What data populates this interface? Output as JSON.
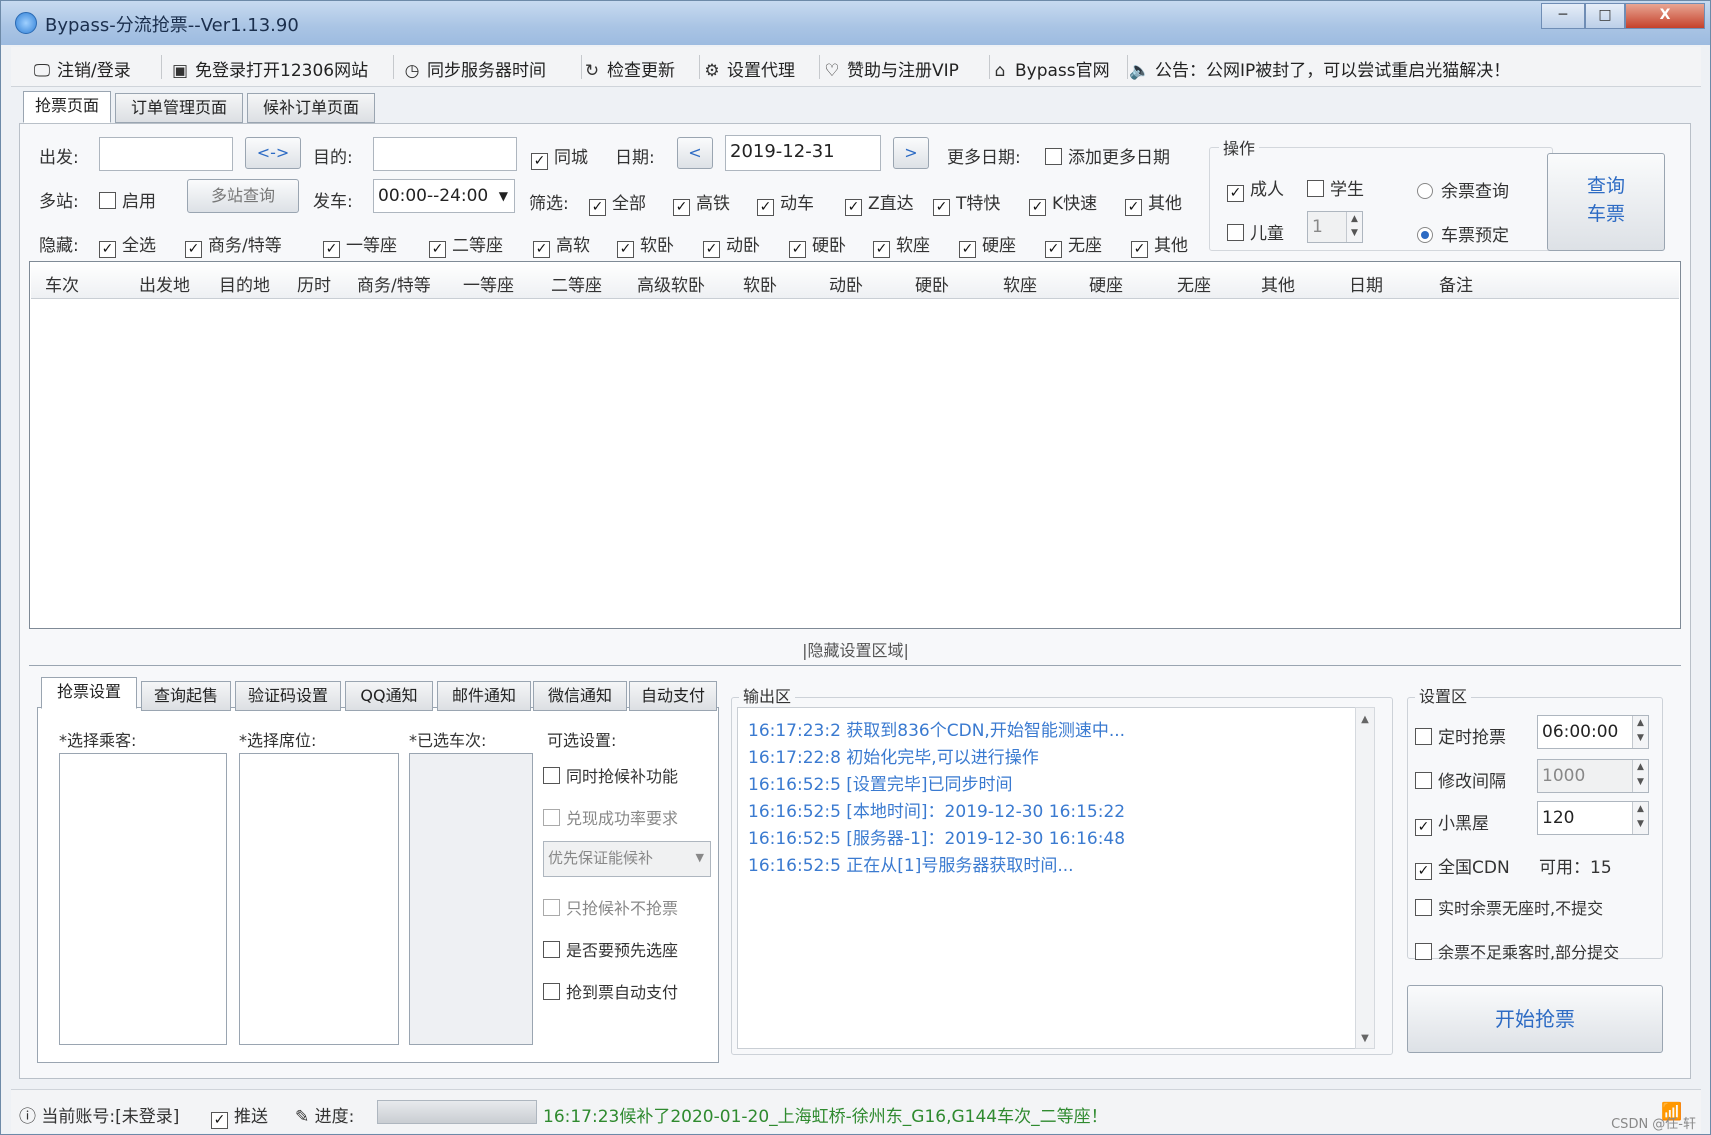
{
  "window": {
    "title": "Bypass-分流抢票--Ver1.13.90",
    "controls": {
      "minimize": "─",
      "maximize": "□",
      "close": "X"
    }
  },
  "toolbar": {
    "items": [
      {
        "icon": "🖵",
        "label": "注销/登录"
      },
      {
        "icon": "▣",
        "label": "免登录打开12306网站"
      },
      {
        "icon": "◷",
        "label": "同步服务器时间"
      },
      {
        "icon": "↻",
        "label": "检查更新"
      },
      {
        "icon": "⚙",
        "label": "设置代理"
      },
      {
        "icon": "♡",
        "label": "赞助与注册VIP"
      },
      {
        "icon": "⌂",
        "label": "Bypass官网"
      },
      {
        "icon": "🔈",
        "label": "公告：公网IP被封了，可以尝试重启光猫解决！"
      }
    ]
  },
  "main_tabs": [
    "抢票页面",
    "订单管理页面",
    "候补订单页面"
  ],
  "query": {
    "from_label": "出发:",
    "from_value": "",
    "swap_label": "<->",
    "to_label": "目的:",
    "to_value": "",
    "same_city_label": "同城",
    "same_city_checked": "✓",
    "date_label": "日期:",
    "date_prev": "<",
    "date_value": "2019-12-31",
    "date_next": ">",
    "more_dates_label": "更多日期:",
    "add_more_dates_label": "添加更多日期",
    "multi_station_label": "多站:",
    "enable_label": "启用",
    "multi_station_query": "多站查询",
    "depart_label": "发车:",
    "depart_value": "00:00--24:00",
    "filter_label": "筛选:",
    "filters": [
      "全部",
      "高铁",
      "动车",
      "Z直达",
      "T特快",
      "K快速",
      "其他"
    ],
    "hide_label": "隐藏:",
    "hides": [
      "全选",
      "商务/特等",
      "一等座",
      "二等座",
      "高软",
      "软卧",
      "动卧",
      "硬卧",
      "软座",
      "硬座",
      "无座",
      "其他"
    ]
  },
  "operation": {
    "group_label": "操作",
    "adult_label": "成人",
    "student_label": "学生",
    "child_label": "儿童",
    "child_count": "1",
    "radio_remaining": "余票查询",
    "radio_reserve": "车票预定",
    "query_button": "查询\n车票",
    "query_line1": "查询",
    "query_line2": "车票"
  },
  "grid": {
    "columns": [
      "车次",
      "出发地",
      "目的地",
      "历时",
      "商务/特等",
      "一等座",
      "二等座",
      "高级软卧",
      "软卧",
      "动卧",
      "硬卧",
      "软座",
      "硬座",
      "无座",
      "其他",
      "日期",
      "备注"
    ]
  },
  "collapse_bar": "|隐藏设置区域|",
  "settings_tabs": [
    "抢票设置",
    "查询起售",
    "验证码设置",
    "QQ通知",
    "邮件通知",
    "微信通知",
    "自动支付"
  ],
  "settings": {
    "select_passenger": "*选择乘客:",
    "select_seat": "*选择席位:",
    "selected_trains": "*已选车次:",
    "optional_label": "可选设置:",
    "opt1": "同时抢候补功能",
    "opt2": "兑现成功率要求",
    "opt_dropdown": "优先保证能候补",
    "opt3": "只抢候补不抢票",
    "opt4": "是否要预先选座",
    "opt5": "抢到票自动支付"
  },
  "output": {
    "label": "输出区",
    "lines": [
      "16:17:23:2  获取到836个CDN,开始智能测速中...",
      "16:17:22:8  初始化完毕,可以进行操作",
      "16:16:52:5  [设置完毕]已同步时间",
      "16:16:52:5  [本地时间]：2019-12-30 16:15:22",
      "16:16:52:5  [服务器-1]：2019-12-30 16:16:48",
      "16:16:52:5  正在从[1]号服务器获取时间..."
    ]
  },
  "settings_area": {
    "label": "设置区",
    "timed_label": "定时抢票",
    "timed_value": "06:00:00",
    "interval_label": "修改间隔",
    "interval_value": "1000",
    "blackroom_label": "小黑屋",
    "blackroom_value": "120",
    "cdn_label": "全国CDN",
    "cdn_available": "可用：15",
    "realtime_label": "实时余票无座时,不提交",
    "partial_label": "余票不足乘客时,部分提交",
    "start_button": "开始抢票"
  },
  "status": {
    "account": "当前账号:[未登录]",
    "push_label": "推送",
    "progress_label": "进度:",
    "progress": 1.0,
    "message": "16:17:23候补了2020-01-20_上海虹桥-徐州东_G16,G144车次_二等座！"
  },
  "watermark": "CSDN @任-轩"
}
